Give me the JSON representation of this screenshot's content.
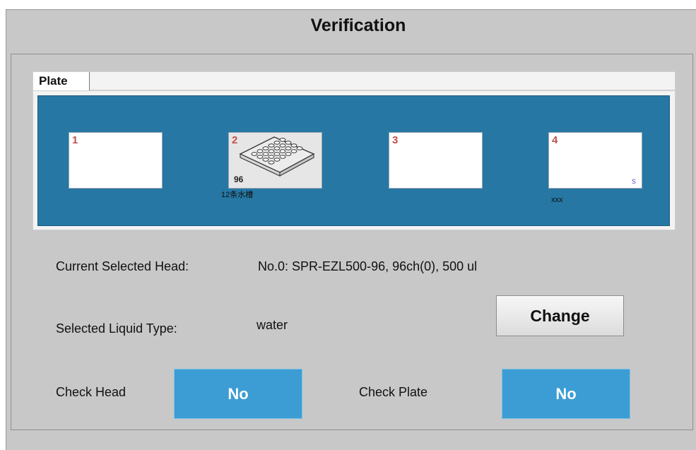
{
  "window": {
    "title": "Verification"
  },
  "tabs": [
    {
      "label": "Plate"
    }
  ],
  "slots": [
    {
      "number": "1",
      "count": "",
      "corner": "",
      "caption": ""
    },
    {
      "number": "2",
      "count": "96",
      "corner": "",
      "caption": "12条水槽"
    },
    {
      "number": "3",
      "count": "",
      "corner": "",
      "caption": ""
    },
    {
      "number": "4",
      "count": "",
      "corner": "s",
      "caption": "xxx"
    }
  ],
  "head": {
    "label": "Current Selected Head:",
    "value": "No.0: SPR-EZL500-96, 96ch(0), 500 ul"
  },
  "liquid": {
    "label": "Selected Liquid Type:",
    "value": "water",
    "change_label": "Change"
  },
  "checks": {
    "head_label": "Check Head",
    "head_value": "No",
    "plate_label": "Check Plate",
    "plate_value": "No"
  },
  "colors": {
    "plate_area": "#2677a4",
    "slot_number": "#c0504d",
    "check_button": "#3b9dd3",
    "window_bg": "#c8c8c8"
  },
  "icons": {
    "plate_icon": "microplate-96-icon"
  }
}
